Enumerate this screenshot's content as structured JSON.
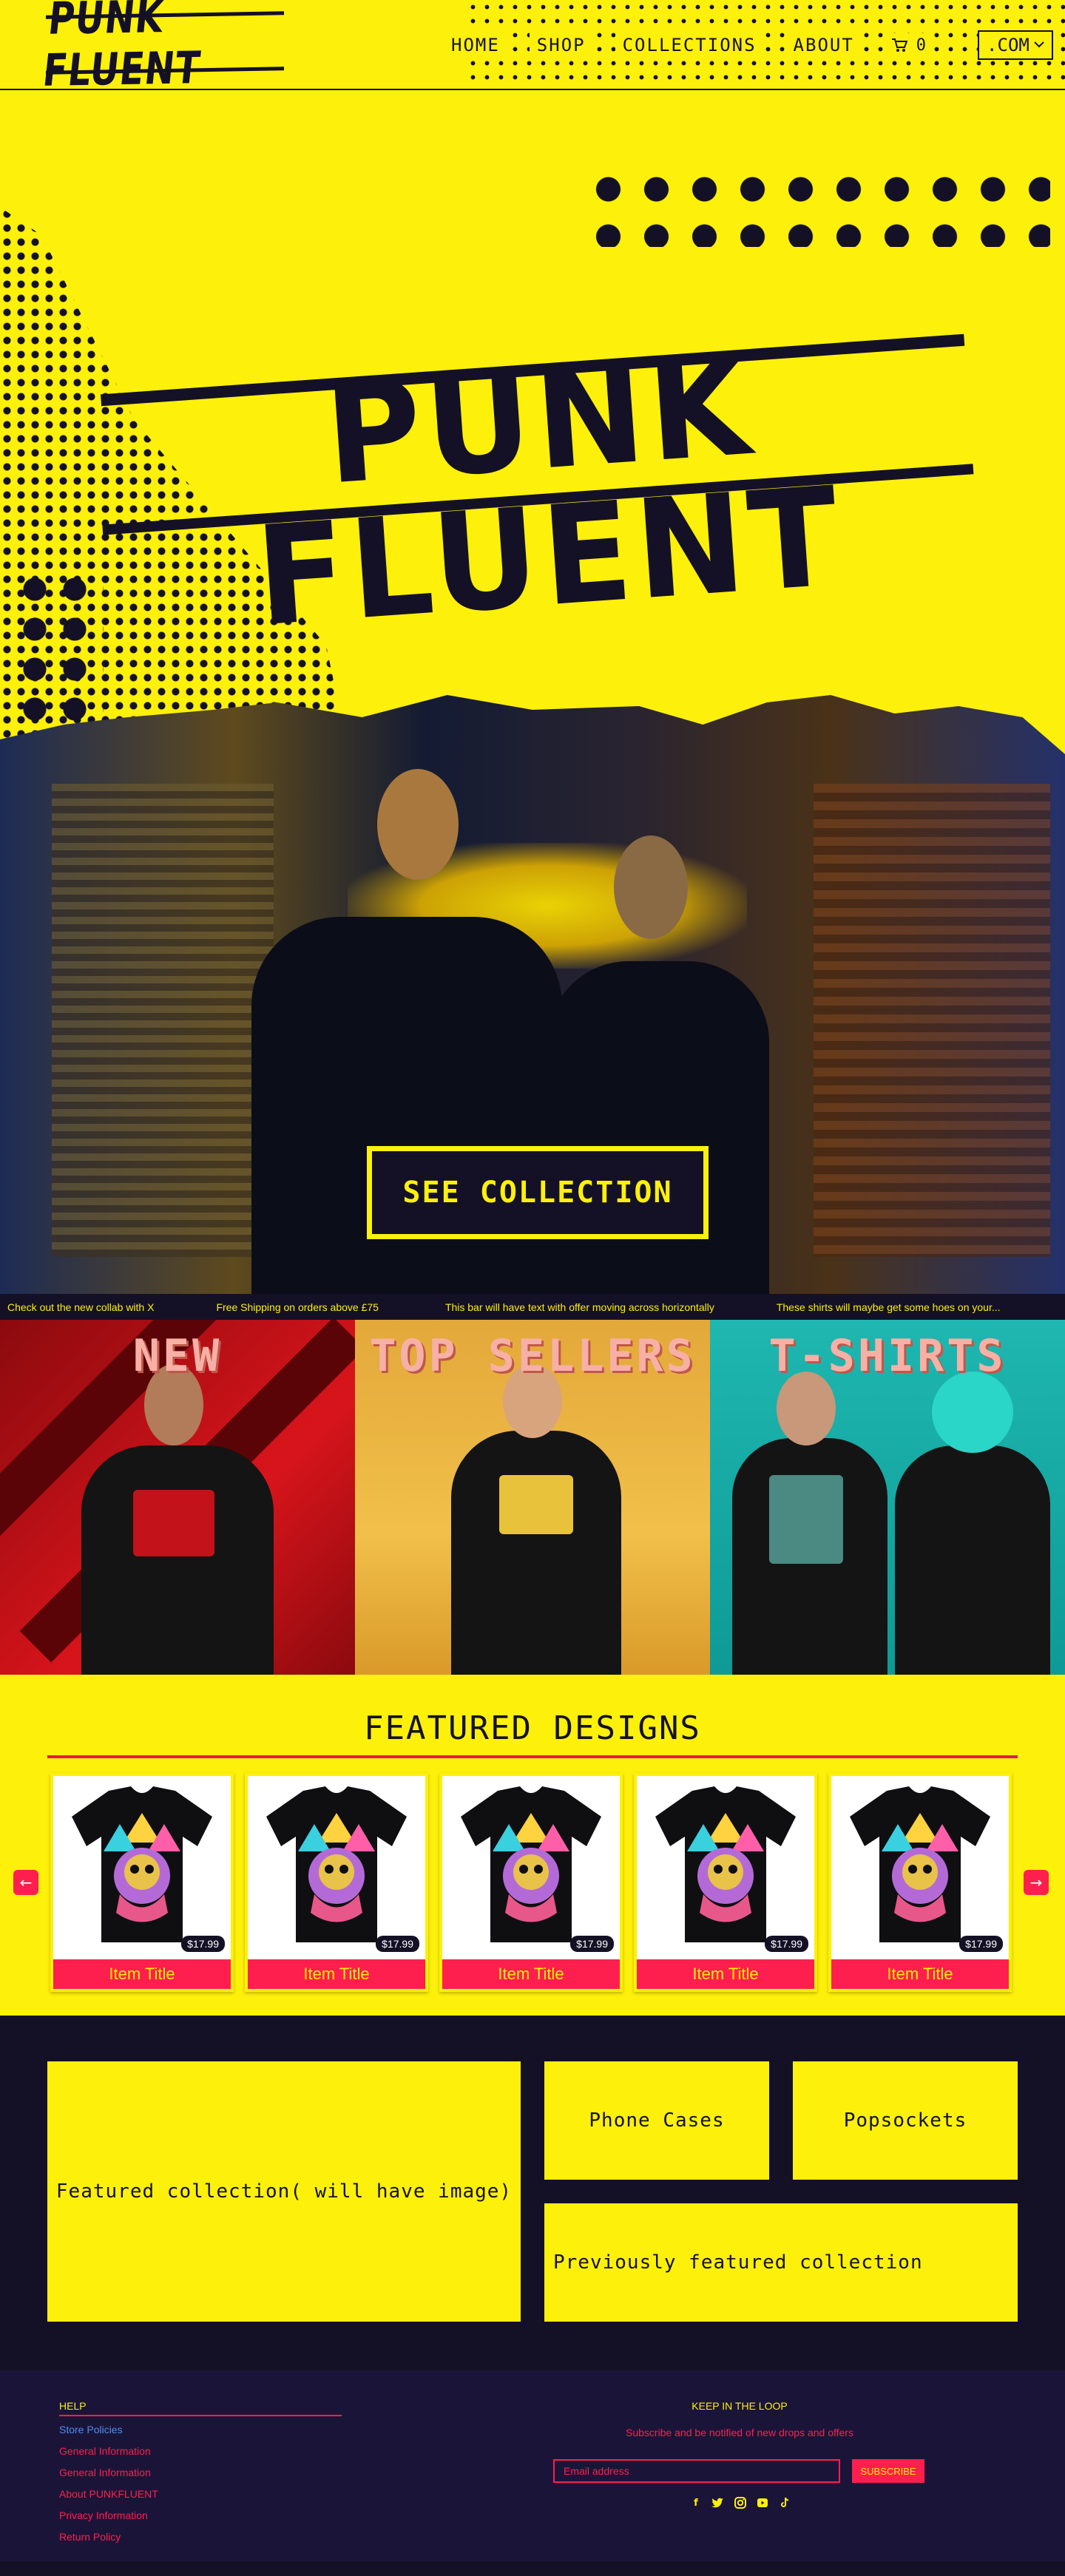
{
  "brand": {
    "logo_text": "PUNK FLUENT",
    "hero_title": "PUNK FLUENT"
  },
  "nav": {
    "items": [
      "HOME",
      "SHOP",
      "COLLECTIONS",
      "ABOUT"
    ],
    "cart_count": "0",
    "domain_selector": ".COM"
  },
  "hero": {
    "cta_label": "SEE COLLECTION"
  },
  "ticker": [
    "Check out the new collab with X",
    "Free Shipping on orders above £75",
    "This bar will have text with offer moving across horizontally",
    "These shirts will maybe get some hoes on your..."
  ],
  "tiles": [
    {
      "title": "NEW"
    },
    {
      "title": "TOP SELLERS"
    },
    {
      "title": "T-SHIRTS"
    }
  ],
  "featured": {
    "title": "FEATURED DESIGNS",
    "products": [
      {
        "title": "Item Title",
        "price": "$17.99"
      },
      {
        "title": "Item Title",
        "price": "$17.99"
      },
      {
        "title": "Item Title",
        "price": "$17.99"
      },
      {
        "title": "Item Title",
        "price": "$17.99"
      },
      {
        "title": "Item Title",
        "price": "$17.99"
      }
    ]
  },
  "collections": {
    "featured": "Featured collection( will have image)",
    "phone_cases": "Phone Cases",
    "popsockets": "Popsockets",
    "previous": "Previously featured collection"
  },
  "footer": {
    "help_heading": "HELP",
    "links": [
      "Store Policies",
      "General Information",
      "General Information",
      "About PUNKFLUENT",
      "Privacy Information",
      "Return Policy"
    ],
    "newsletter_heading": "KEEP IN THE LOOP",
    "newsletter_text": "Subscribe and be notified of new drops and offers",
    "email_placeholder": "Email address",
    "subscribe_label": "SUBSCRIBE",
    "social_icons": [
      "facebook-icon",
      "twitter-icon",
      "instagram-icon",
      "youtube-icon",
      "tiktok-icon"
    ]
  },
  "colors": {
    "brand_yellow": "#fdf00a",
    "ink": "#141126",
    "accent_pink": "#ff1f4e"
  }
}
